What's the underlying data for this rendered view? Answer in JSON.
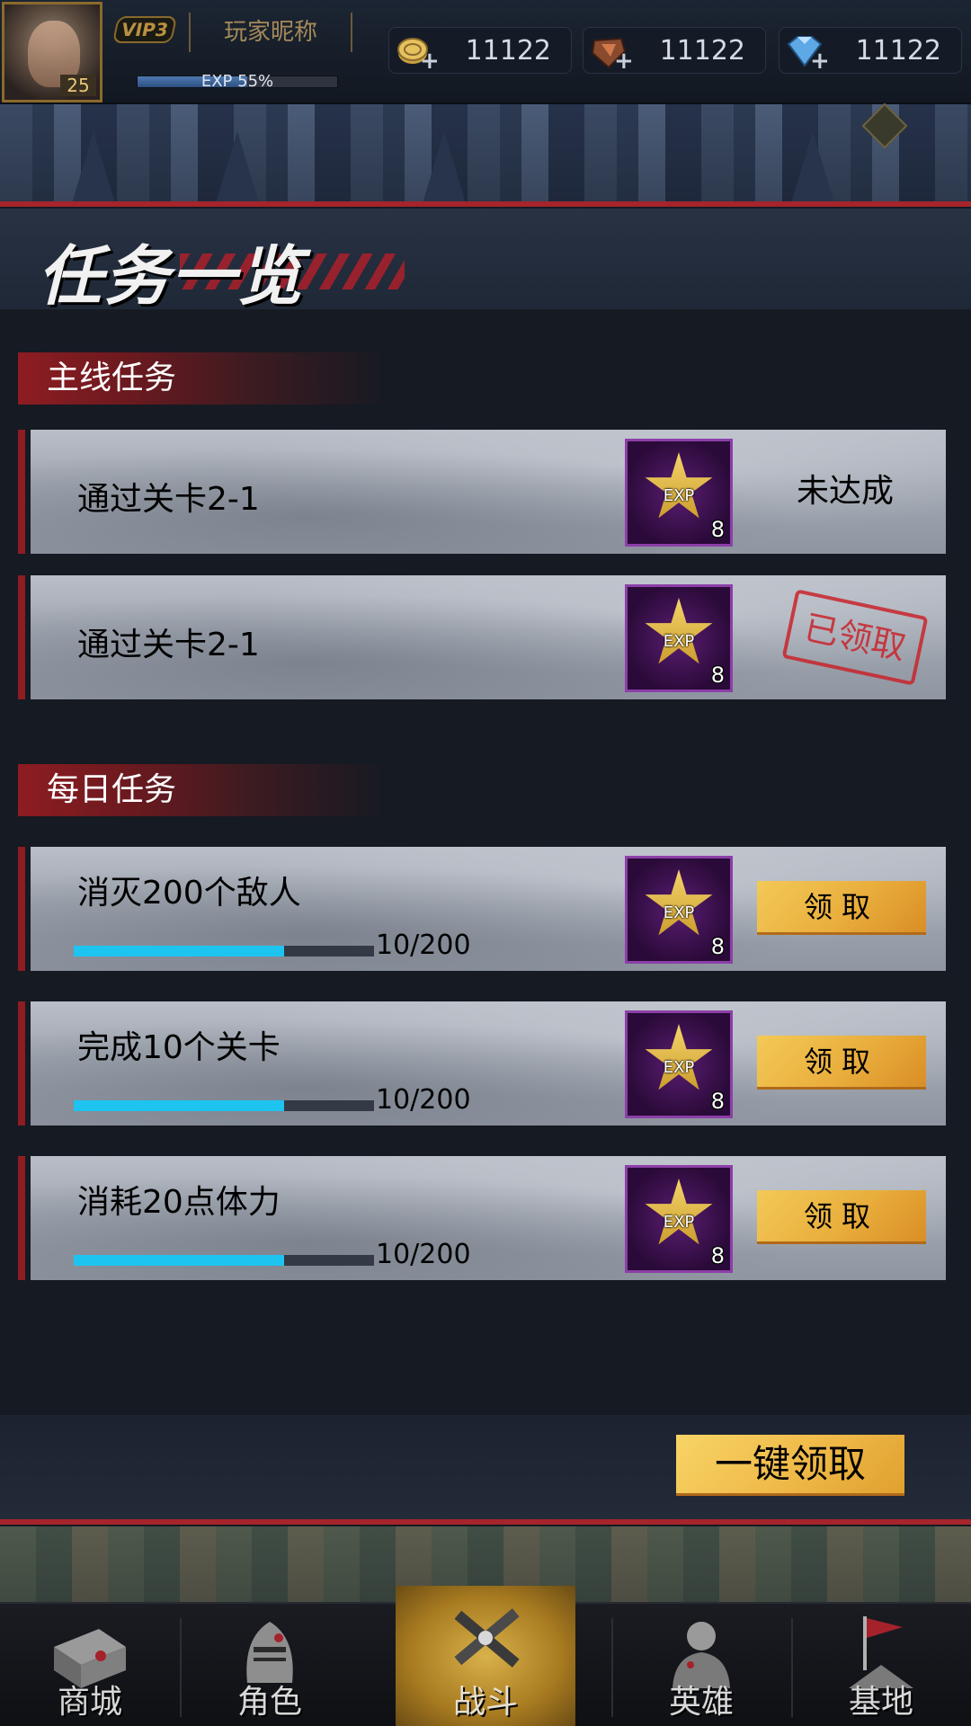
{
  "header": {
    "player_level": "25",
    "vip": "VIP3",
    "nickname": "玩家昵称",
    "exp_text": "EXP 55%",
    "exp_progress": 0.55,
    "resources": [
      {
        "icon": "gold-coin-icon",
        "value": "11122"
      },
      {
        "icon": "crystal-ore-icon",
        "value": "11122"
      },
      {
        "icon": "diamond-icon",
        "value": "11122"
      }
    ]
  },
  "page_title": "任务一览",
  "main_section": {
    "title": "主线任务",
    "tasks": [
      {
        "name": "通过关卡2-1",
        "reward_label": "EXP",
        "reward_count": "8",
        "status": "未达成"
      },
      {
        "name": "通过关卡2-1",
        "reward_label": "EXP",
        "reward_count": "8",
        "status": "已领取"
      }
    ]
  },
  "daily_section": {
    "title": "每日任务",
    "tasks": [
      {
        "name": "消灭200个敌人",
        "progress_text": "10/200",
        "progress": 0.7,
        "reward_label": "EXP",
        "reward_count": "8",
        "button": "领取"
      },
      {
        "name": "完成10个关卡",
        "progress_text": "10/200",
        "progress": 0.7,
        "reward_label": "EXP",
        "reward_count": "8",
        "button": "领取"
      },
      {
        "name": "消耗20点体力",
        "progress_text": "10/200",
        "progress": 0.7,
        "reward_label": "EXP",
        "reward_count": "8",
        "button": "领取"
      }
    ]
  },
  "claim_all": "一键领取",
  "nav": [
    {
      "label": "商城",
      "icon": "shop-icon"
    },
    {
      "label": "角色",
      "icon": "knight-helmet-icon"
    },
    {
      "label": "战斗",
      "icon": "crossed-guns-icon",
      "active": true
    },
    {
      "label": "英雄",
      "icon": "hero-icon"
    },
    {
      "label": "基地",
      "icon": "base-flag-icon"
    }
  ],
  "colors": {
    "accent_red": "#a6242b",
    "claim_gold": "#efb948",
    "progress_cyan": "#1ec4f0",
    "reward_purple": "#5a1d72",
    "stamp_red": "#c9242c"
  }
}
